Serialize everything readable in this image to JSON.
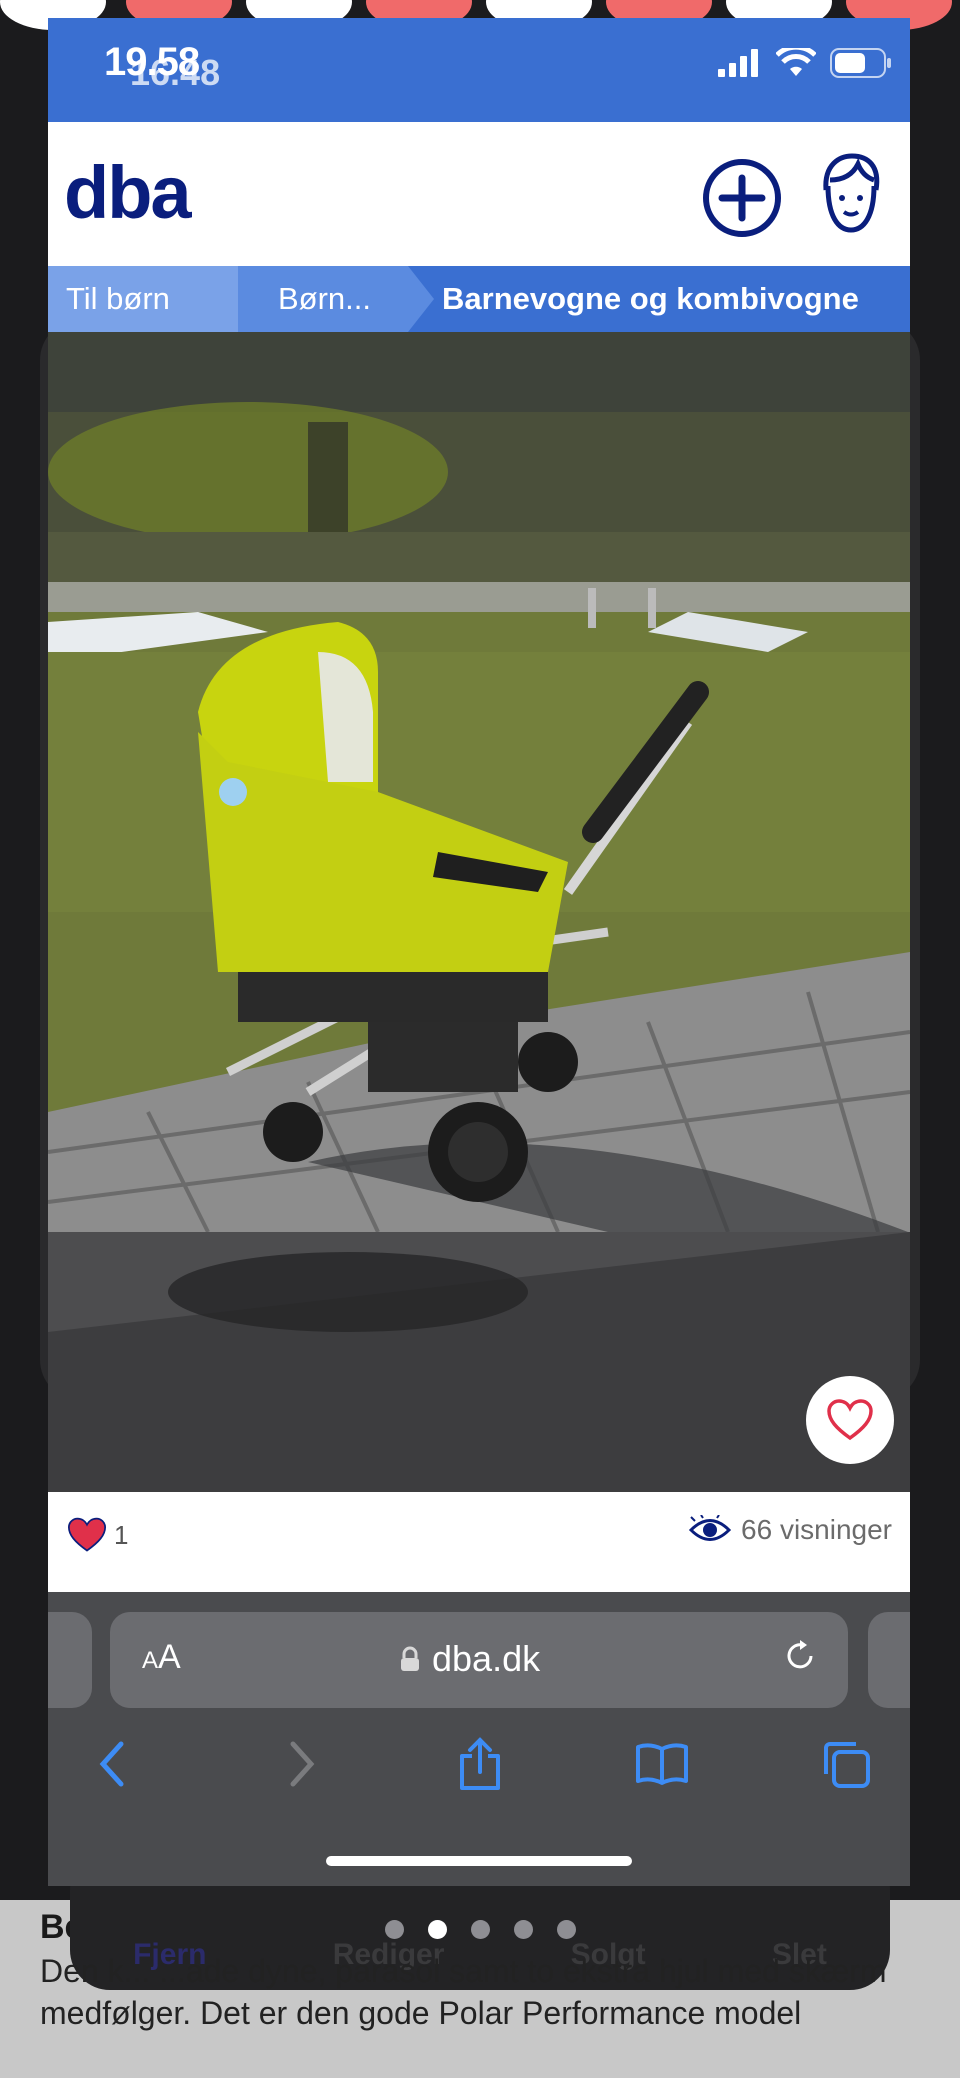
{
  "status_bar": {
    "time": "19.58",
    "time_overlay": "16.48"
  },
  "header": {
    "logo": "dba"
  },
  "breadcrumb": {
    "items": [
      "Til børn",
      "Børn...",
      "Barnevogne og kombivogne"
    ]
  },
  "stats": {
    "likes": "1",
    "views": "66 visninger"
  },
  "safari": {
    "aa_small": "A",
    "aa_large": "A",
    "url": "dba.dk"
  },
  "background": {
    "actions": [
      "Fjern",
      "Rediger",
      "Solgt",
      "Slet"
    ],
    "heading": "Be",
    "text": "Den k... ...ade dyne, parasol samt to ekstra hjul med skærm medfølger. Det er den gode Polar Performance model"
  },
  "page_indicator": {
    "count": 5,
    "active_index": 1
  },
  "colors": {
    "brand": "#0a1e7d",
    "nav_blue": "#3a6fd1",
    "heart": "#e0304a",
    "stroller": "#c8d40f"
  }
}
